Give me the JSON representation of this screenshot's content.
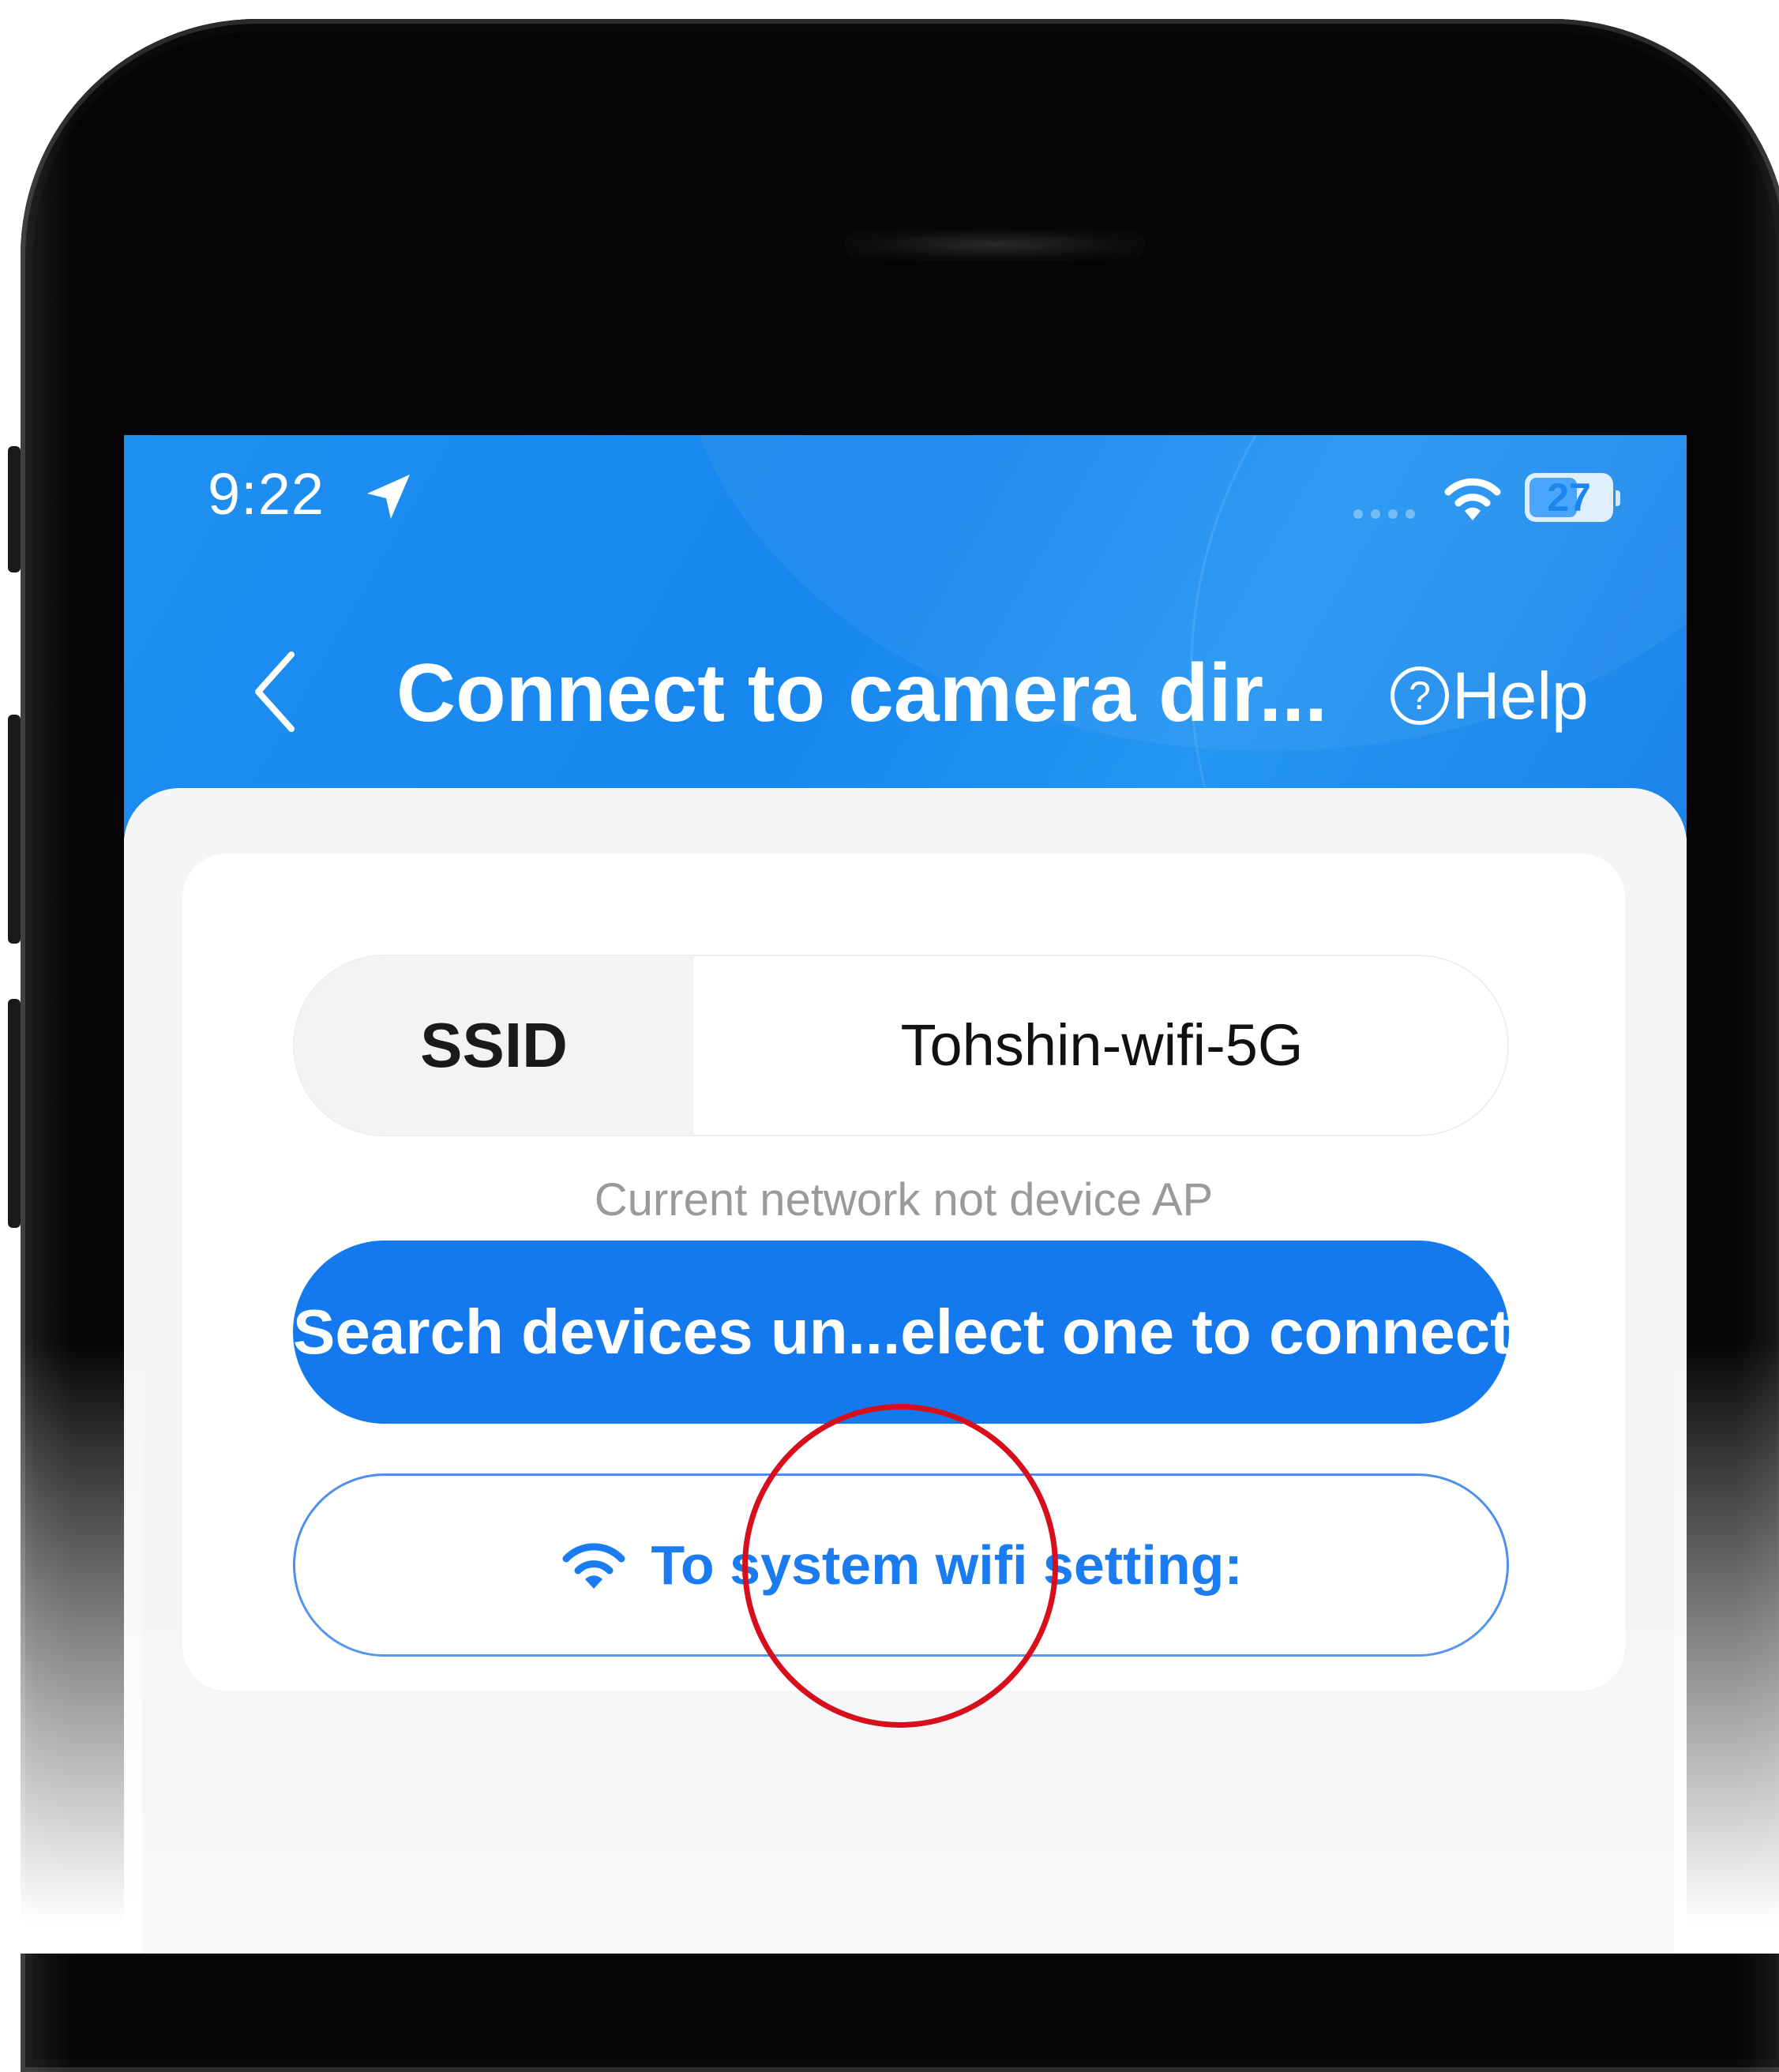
{
  "status_bar": {
    "time": "9:22",
    "battery": "27",
    "icons": [
      "location-arrow-icon",
      "cellular-dots-icon",
      "wifi-icon",
      "battery-icon"
    ]
  },
  "nav": {
    "title": "Connect to camera dir...",
    "help_label": "Help",
    "help_icon_glyph": "?",
    "back_icon": "chevron-left-icon"
  },
  "form": {
    "ssid_label": "SSID",
    "ssid_value": "Tohshin-wifi-5G",
    "hint": "Current network not device AP",
    "search_button_label": "Search devices un...elect one to connect",
    "wifi_settings_label": "To system wifi setting:",
    "wifi_settings_icon": "wifi-icon"
  },
  "colors": {
    "header_blue": "#1786ef",
    "primary_button": "#1479ee",
    "outline_button_text": "#1a7cf0",
    "highlight_circle": "#d70f1d"
  }
}
